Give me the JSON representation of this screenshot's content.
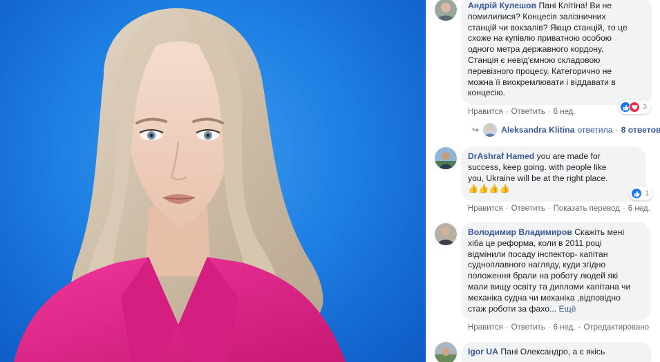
{
  "comments": [
    {
      "author": "Андрій Кулешов",
      "lines": [
        " Пані Клітіна! Ви не",
        "помилилися? Концесія залізничних",
        "станцій чи вокзалів? Якщо станцій, то це",
        "схоже на купівлю приватною особою",
        "одного метра державного кордону.",
        "Станція є невід'ємною складовою",
        "перевізного процесу. Категорично не",
        "можна її виокремлювати і віддавати в",
        "концесію."
      ],
      "like_label": "Нравится",
      "reply_label": "Ответить",
      "time": "6 нед.",
      "reaction_count": "3",
      "reactions": [
        "like-icon",
        "love-icon"
      ],
      "replies": {
        "name": "Aleksandra Klitina",
        "verb": "ответила",
        "count_text": "8 ответов"
      }
    },
    {
      "author": "DrAshraf Hamed",
      "lines": [
        " you are made for",
        "success, keep going. with people like",
        "you, Ukraine will be at the right place.",
        "👍👍👍👍"
      ],
      "like_label": "Нравится",
      "reply_label": "Ответить",
      "translate_label": "Показать перевод",
      "time": "6 нед.",
      "reaction_count": "1",
      "reactions": [
        "like-icon"
      ]
    },
    {
      "author": "Володимир Владимиров",
      "lines": [
        " Скажіть мені",
        "хіба це реформа, коли в 2011 році",
        "відмінили посаду інспектор- капітан",
        "судноплавного нагляду, куди згідно",
        "положення брали на роботу людей які",
        "мали вищу освіту та дипломи капітана чи",
        "механіка судна чи механіка ,відповідно",
        "стаж роботи за фахо..."
      ],
      "more_label": "Ещё",
      "like_label": "Нравится",
      "reply_label": "Ответить",
      "time": "6 нед.",
      "edited_label": "Отредактировано"
    },
    {
      "author": "Igor UA",
      "lines": [
        " Пані Олександро, а є якісь"
      ]
    }
  ],
  "colors": {
    "link": "#385898",
    "bubble": "#f2f3f5",
    "photo_bg": "#1f80e3",
    "jacket": "#e8248a"
  }
}
